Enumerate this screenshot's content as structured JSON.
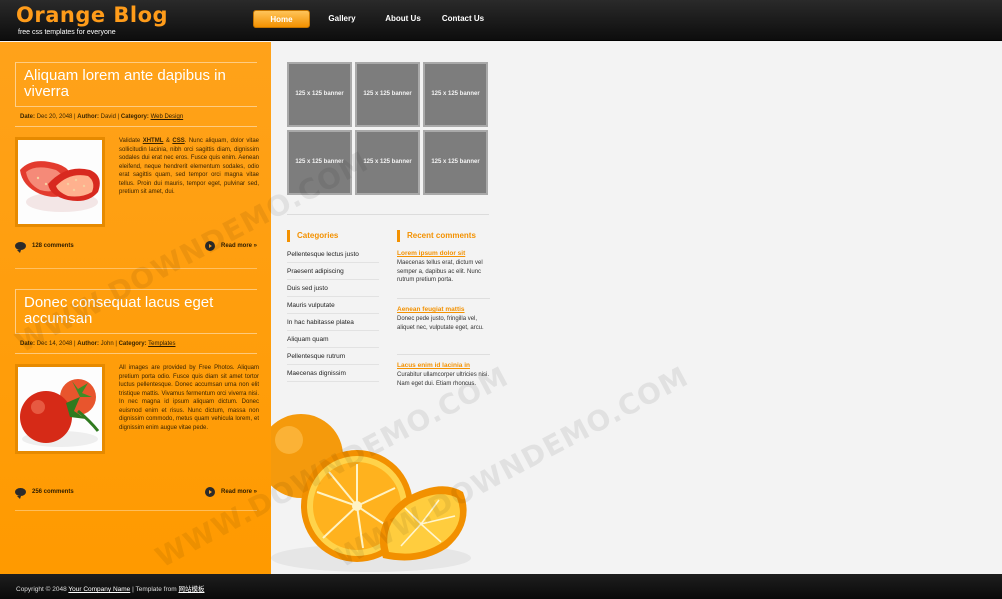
{
  "header": {
    "logo": "Orange Blog",
    "slogan": "free css templates for everyone"
  },
  "nav": {
    "items": [
      "Home",
      "Gallery",
      "About Us",
      "Contact Us"
    ],
    "active": "Home"
  },
  "posts": [
    {
      "title": "Aliquam lorem ante dapibus in viverra",
      "date_label": "Date:",
      "date": "Dec 20, 2048",
      "author_label": "Author:",
      "author": "David",
      "category_label": "Category:",
      "category": "Web Design",
      "excerpt_pre": "Validate ",
      "link1": "XHTML",
      "amp": " & ",
      "link2": "CSS",
      "excerpt_post": ". Nunc aliquam, dolor vitae sollicitudin lacinia, nibh orci sagittis diam, dignissim sodales dui erat nec eros. Fusce quis enim. Aenean eleifend, neque hendrerit elementum sodales, odio erat sagittis quam, sed tempor orci magna vitae tellus. Proin dui mauris, tempor eget, pulvinar sed, pretium sit amet, dui.",
      "comments": "128 comments",
      "read_more": "Read more »",
      "thumb_icon": "strawberry-image"
    },
    {
      "title": "Donec consequat lacus eget accumsan",
      "date_label": "Date:",
      "date": "Dec 14, 2048",
      "author_label": "Author:",
      "author": "John",
      "category_label": "Category:",
      "category": "Templates",
      "excerpt": "All images are provided by Free Photos. Aliquam pretium porta odio. Fusce quis diam sit amet tortor luctus pellentesque. Donec accumsan urna non elit tristique mattis. Vivamus fermentum orci viverra nisi. In nec magna id ipsum aliquam dictum. Donec euismod enim et risus. Nunc dictum, massa non dignissim commodo, metus quam vehicula lorem, et dignissim enim augue vitae pede.",
      "comments": "256 comments",
      "read_more": "Read more »",
      "thumb_icon": "tomato-image"
    }
  ],
  "banners": [
    "125 x 125 banner",
    "125 x 125 banner",
    "125 x 125 banner",
    "125 x 125 banner",
    "125 x 125 banner",
    "125 x 125 banner"
  ],
  "categories": {
    "title": "Categories",
    "items": [
      "Pellentesque lectus justo",
      "Praesent adipiscing",
      "Duis sed justo",
      "Mauris vulputate",
      "In hac habitasse platea",
      "Aliquam quam",
      "Pellentesque rutrum",
      "Maecenas dignissim"
    ]
  },
  "recent_comments": {
    "title": "Recent comments",
    "items": [
      {
        "title": "Lorem ipsum dolor sit",
        "text": "Maecenas tellus erat, dictum vel semper a, dapibus ac elit. Nunc rutrum pretium porta."
      },
      {
        "title": "Aenean feugiat mattis",
        "text": "Donec pede justo, fringilla vel, aliquet nec, vulputate eget, arcu."
      },
      {
        "title": "Lacus enim id lacinia in",
        "text": "Curabitur ullamcorper ultricies nisi. Nam eget dui. Etiam rhoncus."
      }
    ]
  },
  "footer": {
    "copyright": "Copyright © 2048 ",
    "company": "Your Company Name",
    "separator": " | Template from ",
    "source": "网站模板"
  },
  "watermark": "WWW.DOWNDEMO.COM",
  "colors": {
    "accent": "#f39100",
    "left_bg": "#ffa11a",
    "header_bg": "#111111"
  }
}
